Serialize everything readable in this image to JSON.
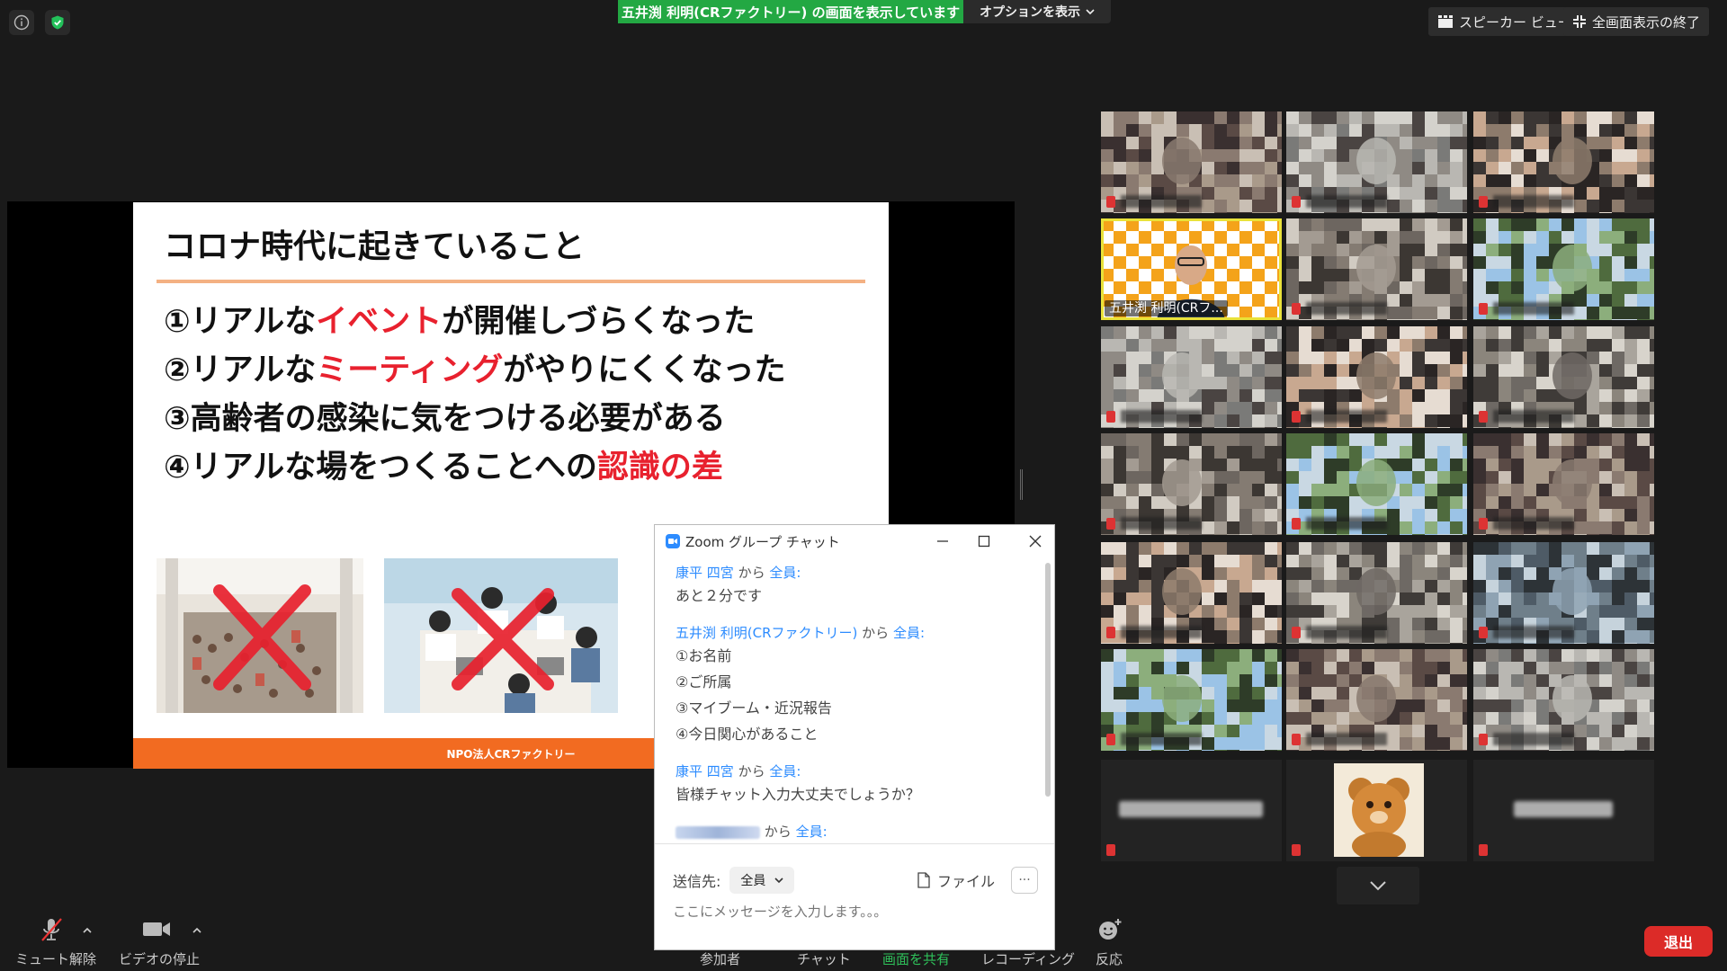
{
  "banner": {
    "sharing_text": "五井渕 利明(CRファクトリー) の画面を表示しています",
    "options_label": "オプションを表示"
  },
  "top_right": {
    "speaker_view": "スピーカー ビュー",
    "exit_fullscreen": "全画面表示の終了"
  },
  "slide": {
    "title": "コロナ時代に起きていること",
    "lines": [
      {
        "pre": "①リアルな",
        "red": "イベント",
        "post": "が開催しづらくなった"
      },
      {
        "pre": "②リアルな",
        "red": "ミーティング",
        "post": "がやりにくくなった"
      },
      {
        "pre": "③高齢者の感染に気をつける必要がある",
        "red": "",
        "post": ""
      },
      {
        "pre": "④リアルな場をつくることへの",
        "red": "認識の差",
        "post": ""
      }
    ],
    "footer": "NPO法人CRファクトリー"
  },
  "chat": {
    "title": "Zoom グループ チャット",
    "from_word": "から",
    "messages": [
      {
        "sender": "康平 四宮",
        "to": "全員:",
        "lines": [
          "あと２分です"
        ]
      },
      {
        "sender": "五井渕 利明(CRファクトリー)",
        "to": "全員:",
        "lines": [
          "①お名前",
          "②ご所属",
          "③マイブーム・近況報告",
          "④今日関心があること"
        ]
      },
      {
        "sender": "康平 四宮",
        "to": "全員:",
        "lines": [
          "皆様チャット入力大丈夫でしょうか？"
        ]
      },
      {
        "sender": "",
        "to": "全員:",
        "lines": []
      }
    ],
    "send_to_label": "送信先:",
    "send_to_value": "全員",
    "file_label": "ファイル",
    "more_label": "···",
    "input_placeholder": "ここにメッセージを入力します。。。"
  },
  "gallery": {
    "active_name": "五井渕 利明(CRフ..."
  },
  "toolbar": {
    "unmute": "ミュート解除",
    "stop_video": "ビデオの停止",
    "participants": "参加者",
    "chat": "チャット",
    "share_screen": "画面を共有",
    "record": "レコーディング",
    "reactions": "反応",
    "leave": "退出"
  },
  "colors": {
    "share_green": "#23a843",
    "accent_red": "#e8212e",
    "slide_orange": "#f26b21",
    "zoom_blue": "#2d8cff",
    "leave_red": "#dc2b28",
    "active_yellow": "#e9e23a"
  }
}
